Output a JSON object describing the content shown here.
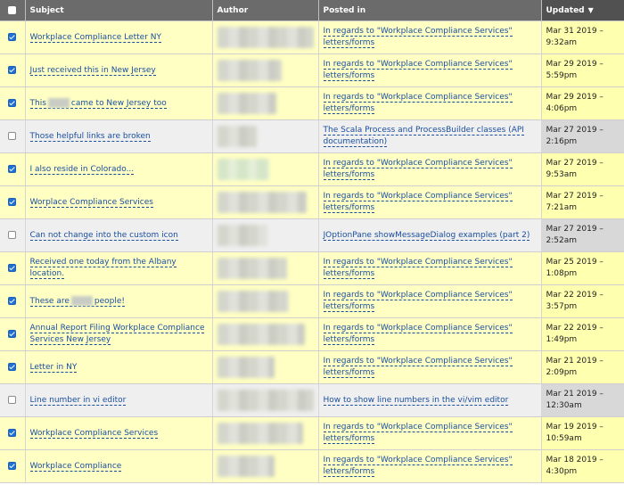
{
  "columns": {
    "subject": "Subject",
    "author": "Author",
    "posted_in": "Posted in",
    "updated": "Updated",
    "sort_indicator": "▼"
  },
  "rows": [
    {
      "checked": true,
      "row_bg": "yellow",
      "subject": "Workplace Compliance Letter NY",
      "subject_blur_after": "",
      "posted_in_line1": "In regards to \"Workplace Compliance Services\"",
      "posted_in_line2": "letters/forms",
      "updated_line1": "Mar 31 2019 –",
      "updated_line2": "9:32am"
    },
    {
      "checked": true,
      "row_bg": "yellow",
      "subject": "Just received this in New Jersey",
      "posted_in_line1": "In regards to \"Workplace Compliance Services\"",
      "posted_in_line2": "letters/forms",
      "updated_line1": "Mar 29 2019 –",
      "updated_line2": "5:59pm"
    },
    {
      "checked": true,
      "row_bg": "yellow",
      "subject_before_blur": "This",
      "subject_after_blur": "came to New Jersey too",
      "posted_in_line1": "In regards to \"Workplace Compliance Services\"",
      "posted_in_line2": "letters/forms",
      "updated_line1": "Mar 29 2019 –",
      "updated_line2": "4:06pm"
    },
    {
      "checked": false,
      "row_bg": "gray",
      "subject": "Those helpful links are broken",
      "posted_in_line1": "The Scala Process and ProcessBuilder classes (API",
      "posted_in_line2": "documentation)",
      "updated_line1": "Mar 27 2019 –",
      "updated_line2": "2:16pm"
    },
    {
      "checked": true,
      "row_bg": "yellow",
      "subject": "I also reside in Colorado...",
      "posted_in_line1": "In regards to \"Workplace Compliance Services\"",
      "posted_in_line2": "letters/forms",
      "updated_line1": "Mar 27 2019 –",
      "updated_line2": "9:53am"
    },
    {
      "checked": true,
      "row_bg": "yellow",
      "subject": "Worplace Compliance Services",
      "posted_in_line1": "In regards to \"Workplace Compliance Services\"",
      "posted_in_line2": "letters/forms",
      "updated_line1": "Mar 27 2019 –",
      "updated_line2": "7:21am"
    },
    {
      "checked": false,
      "row_bg": "gray",
      "subject": "Can not change into the custom icon",
      "posted_in_line1": "JOptionPane showMessageDialog examples (part 2)",
      "posted_in_line2": "",
      "updated_line1": "Mar 27 2019 –",
      "updated_line2": "2:52am"
    },
    {
      "checked": true,
      "row_bg": "yellow",
      "subject": "Received one today from the Albany location.",
      "posted_in_line1": "In regards to \"Workplace Compliance Services\"",
      "posted_in_line2": "letters/forms",
      "updated_line1": "Mar 25 2019 –",
      "updated_line2": "1:08pm"
    },
    {
      "checked": true,
      "row_bg": "yellow",
      "subject_before_blur": "These are",
      "subject_after_blur": "people!",
      "posted_in_line1": "In regards to \"Workplace Compliance Services\"",
      "posted_in_line2": "letters/forms",
      "updated_line1": "Mar 22 2019 –",
      "updated_line2": "3:57pm"
    },
    {
      "checked": true,
      "row_bg": "yellow",
      "subject": "Annual Report Filing Workplace Compliance",
      "subject_line2": "Services New Jersey",
      "posted_in_line1": "In regards to \"Workplace Compliance Services\"",
      "posted_in_line2": "letters/forms",
      "updated_line1": "Mar 22 2019 –",
      "updated_line2": "1:49pm"
    },
    {
      "checked": true,
      "row_bg": "yellow",
      "subject": "Letter in NY",
      "posted_in_line1": "In regards to \"Workplace Compliance Services\"",
      "posted_in_line2": "letters/forms",
      "updated_line1": "Mar 21 2019 –",
      "updated_line2": "2:09pm"
    },
    {
      "checked": false,
      "row_bg": "gray",
      "subject": "Line number in vi editor",
      "posted_in_line1": "How to show line numbers in the vi/vim editor",
      "posted_in_line2": "",
      "updated_line1": "Mar 21 2019 –",
      "updated_line2": "12:30am"
    },
    {
      "checked": true,
      "row_bg": "yellow",
      "subject": "Workplace Compliance Services",
      "posted_in_line1": "In regards to \"Workplace Compliance Services\"",
      "posted_in_line2": "letters/forms",
      "updated_line1": "Mar 19 2019 –",
      "updated_line2": "10:59am"
    },
    {
      "checked": true,
      "row_bg": "yellow",
      "subject": "Workplace Compliance",
      "posted_in_line1": "In regards to \"Workplace Compliance Services\"",
      "posted_in_line2": "letters/forms",
      "updated_line1": "Mar 18 2019 –",
      "updated_line2": "4:30pm"
    }
  ],
  "colors": {
    "header_bg": "#6b6b6b",
    "row_yellow": "#ffffc3",
    "row_gray": "#efefef",
    "link": "#1a4fa0",
    "checkbox_blue": "#1f6fd4"
  }
}
